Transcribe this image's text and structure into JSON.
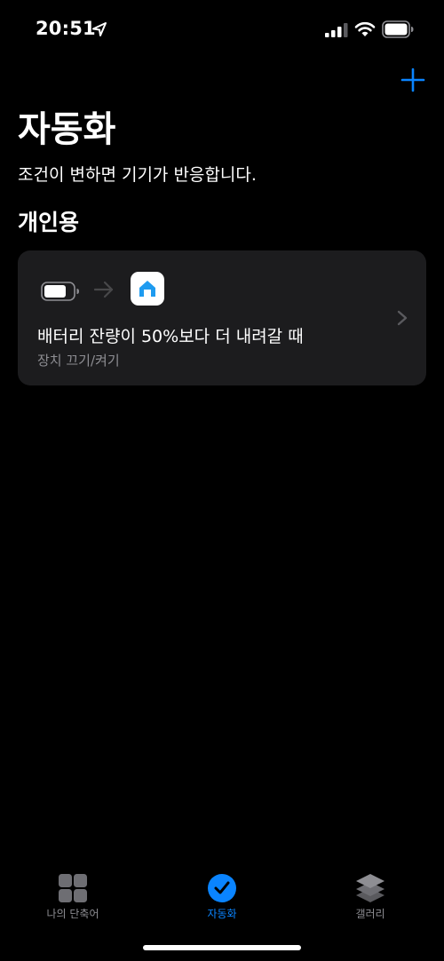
{
  "status_bar": {
    "time": "20:51",
    "icons": [
      "location-arrow-icon",
      "signal-icon",
      "wifi-icon",
      "battery-icon"
    ]
  },
  "header": {
    "add_icon": "plus-icon",
    "title": "자동화",
    "subtitle": "조건이 변하면 기기가 반응합니다."
  },
  "section": {
    "title": "개인용"
  },
  "automation": {
    "trigger_icon": "battery-icon",
    "arrow_icon": "arrow-right-icon",
    "action_icon": "home-app-icon",
    "title": "배터리 잔량이 50%보다 더 내려갈 때",
    "description": "장치 끄기/켜기"
  },
  "tabs": [
    {
      "label": "나의 단축어",
      "icon": "grid-icon",
      "active": false
    },
    {
      "label": "자동화",
      "icon": "clock-check-icon",
      "active": true
    },
    {
      "label": "갤러리",
      "icon": "layers-icon",
      "active": false
    }
  ],
  "colors": {
    "background": "#000000",
    "card": "#1c1c1e",
    "accent": "#0a84ff",
    "secondary_text": "#8e8e93"
  }
}
